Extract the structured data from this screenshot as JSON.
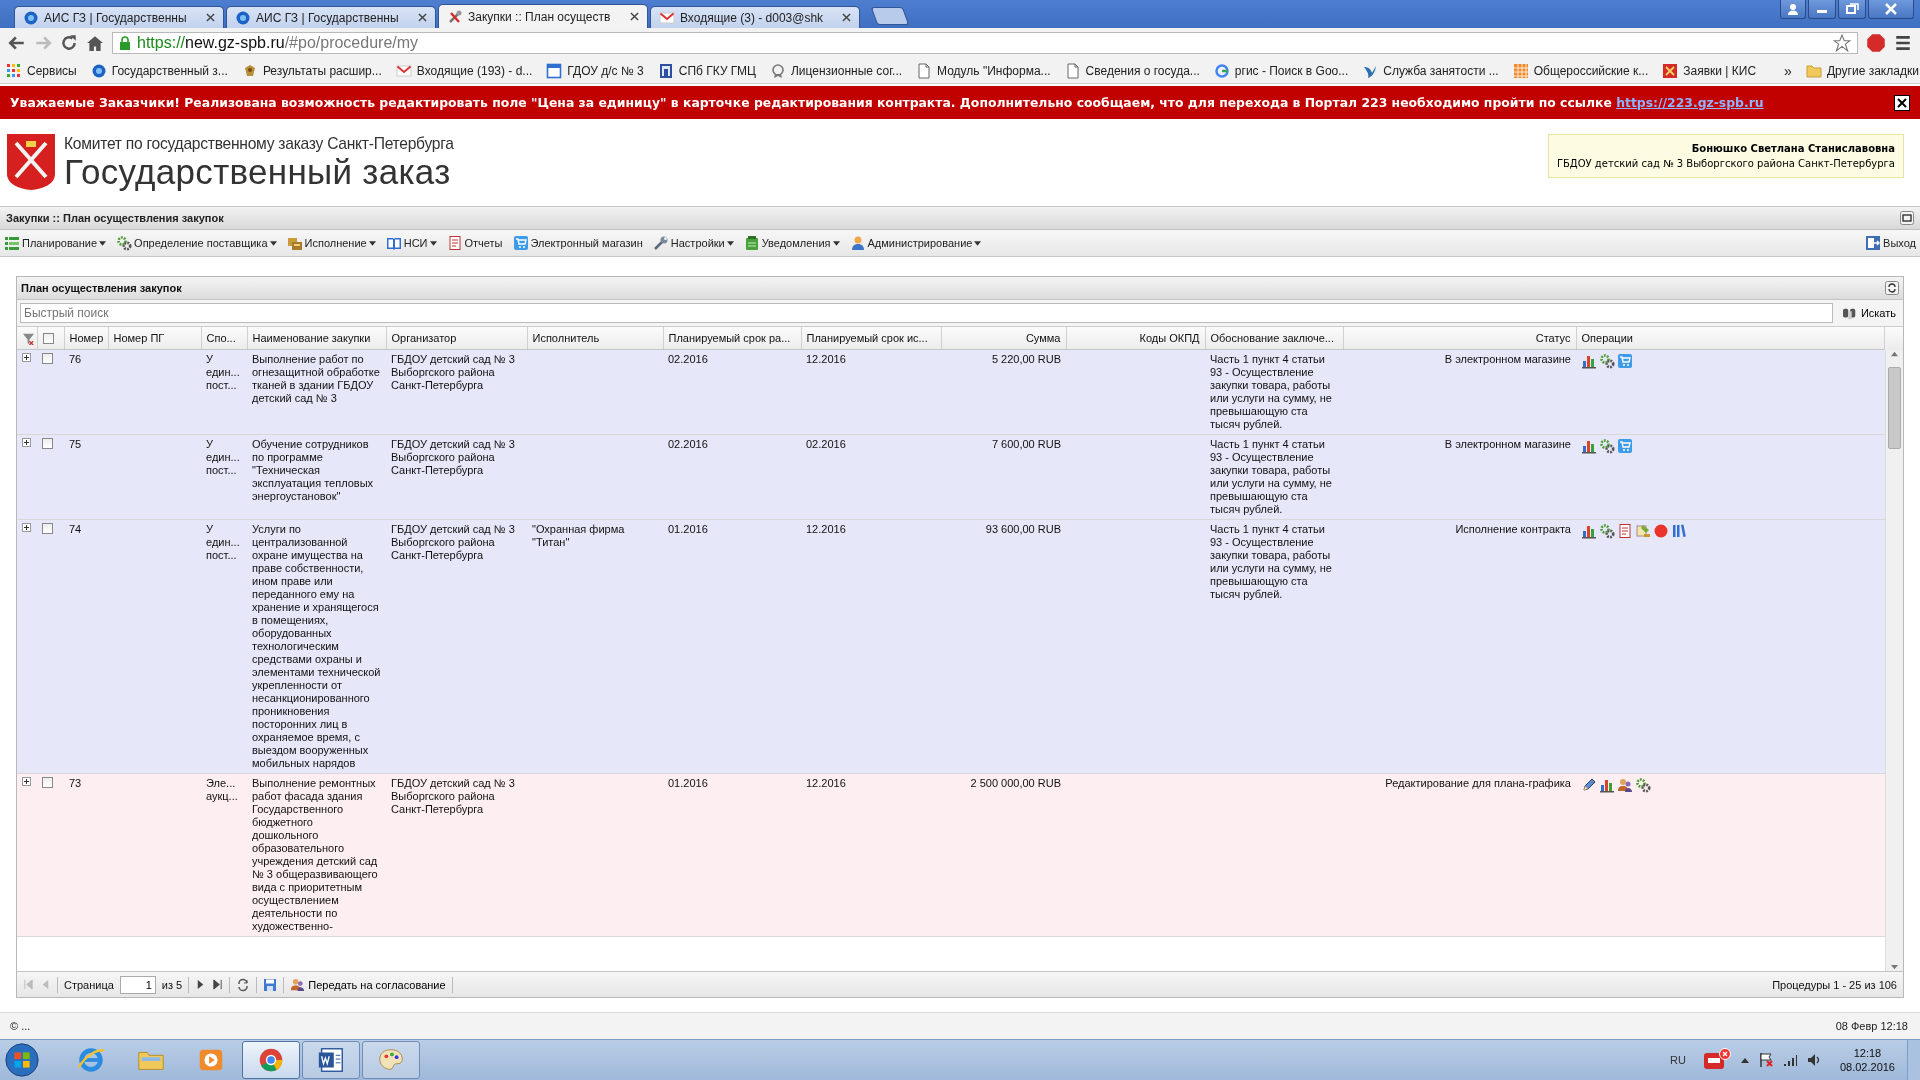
{
  "browser": {
    "tabs": [
      {
        "title": "АИС ГЗ | Государственны",
        "kind": "globe",
        "selected": false
      },
      {
        "title": "АИС ГЗ | Государственны",
        "kind": "globe",
        "selected": false
      },
      {
        "title": "Закупки :: План осуществ",
        "kind": "tools",
        "selected": true
      },
      {
        "title": "Входящие (3) - d003@shk",
        "kind": "mail",
        "selected": false
      }
    ],
    "url": {
      "scheme": "https://",
      "host": "new.gz-spb.ru",
      "path": "/#po/procedure/my"
    },
    "bookmarks": [
      {
        "label": "Сервисы",
        "kind": "apps"
      },
      {
        "label": "Государственный з...",
        "kind": "globe"
      },
      {
        "label": "Результаты расшир...",
        "kind": "emblem"
      },
      {
        "label": "Входящие (193) - d...",
        "kind": "mail"
      },
      {
        "label": "ГДОУ д/с № 3",
        "kind": "calendar"
      },
      {
        "label": "СПб ГКУ ГМЦ",
        "kind": "building"
      },
      {
        "label": "Лицензионные сог...",
        "kind": "badge"
      },
      {
        "label": "Модуль \"Информа...",
        "kind": "page"
      },
      {
        "label": "Сведения о госуда...",
        "kind": "page"
      },
      {
        "label": "ргис - Поиск в Goo...",
        "kind": "ring"
      },
      {
        "label": "Служба занятости ...",
        "kind": "bird"
      },
      {
        "label": "Общероссийские к...",
        "kind": "grid"
      },
      {
        "label": "Заявки | КИС",
        "kind": "crest"
      }
    ],
    "overflow": "»",
    "other_bookmarks": "Другие закладки"
  },
  "banner": {
    "text": "Уважаемые Заказчики! Реализована возможность редактировать поле \"Цена за единицу\" в карточке редактирования контракта. Дополнительно сообщаем, что для перехода в Портал 223 необходимо пройти по ссылке",
    "link": "https://223.gz-spb.ru"
  },
  "header": {
    "subtitle": "Комитет по государственному заказу Санкт-Петербурга",
    "title": "Государственный заказ",
    "user": {
      "name": "Бонюшко Светлана Станиславовна",
      "org": "ГБДОУ детский сад № 3 Выборгского района Санкт-Петербурга"
    }
  },
  "breadcrumb": "Закупки :: План осуществления закупок",
  "menu": [
    {
      "label": "Планирование",
      "kind": "list",
      "dropdown": true
    },
    {
      "label": "Определение поставщика",
      "kind": "gear",
      "dropdown": true
    },
    {
      "label": "Исполнение",
      "kind": "folder",
      "dropdown": true
    },
    {
      "label": "НСИ",
      "kind": "book",
      "dropdown": true
    },
    {
      "label": "Отчеты",
      "kind": "doc",
      "dropdown": false
    },
    {
      "label": "Электронный магазин",
      "kind": "cart",
      "dropdown": false
    },
    {
      "label": "Настройки",
      "kind": "wrench",
      "dropdown": true
    },
    {
      "label": "Уведомления",
      "kind": "notepad",
      "dropdown": true
    },
    {
      "label": "Администрирование",
      "kind": "person",
      "dropdown": true
    }
  ],
  "logout": "Выход",
  "panel": {
    "title": "План осуществления закупок",
    "search": {
      "placeholder": "Быстрый поиск",
      "button": "Искать"
    },
    "all_checked": false,
    "columns": [
      "Номер",
      "Номер ПГ",
      "Спо...",
      "Наименование закупки",
      "Организатор",
      "Исполнитель",
      "Планируемый срок ра...",
      "Планируемый срок ис...",
      "Сумма",
      "Коды ОКПД",
      "Обоснование заключе...",
      "Статус",
      "Операции"
    ],
    "rows": [
      {
        "expanded": false,
        "checked": false,
        "color": "#e6e7f8",
        "number": "76",
        "method": "У един... пост...",
        "name": "Выполнение работ по огнезащитной обработке тканей в здании ГБДОУ детский сад № 3",
        "organizer": "ГБДОУ детский сад № 3 Выборгского района Санкт-Петербурга",
        "start": "02.2016",
        "end": "12.2016",
        "sum": "5 220,00 RUB",
        "basis": "Часть 1 пункт 4 статьи 93 - Осуществление закупки товара, работы или услуги на сумму, не превышающую ста тысяч рублей.",
        "status": "В электронном магазине",
        "operations": [
          {
            "kind": "chart"
          },
          {
            "kind": "gear"
          },
          {
            "kind": "cart"
          }
        ]
      },
      {
        "expanded": false,
        "checked": false,
        "color": "#e6e7f8",
        "number": "75",
        "method": "У един... пост...",
        "name": "Обучение сотрудников по программе \"Техническая эксплуатация тепловых энергоустановок\"",
        "organizer": "ГБДОУ детский сад № 3 Выборгского района Санкт-Петербурга",
        "start": "02.2016",
        "end": "02.2016",
        "sum": "7 600,00 RUB",
        "basis": "Часть 1 пункт 4 статьи 93 - Осуществление закупки товара, работы или услуги на сумму, не превышающую ста тысяч рублей.",
        "status": "В электронном магазине",
        "operations": [
          {
            "kind": "chart"
          },
          {
            "kind": "gear"
          },
          {
            "kind": "cart"
          }
        ]
      },
      {
        "expanded": false,
        "checked": false,
        "color": "#e6e7f8",
        "number": "74",
        "method": "У един... пост...",
        "name": "Услуги по централизованной охране имущества на праве собственности, ином праве или переданного ему на хранение и хранящегося в помещениях, оборудованных технологическим средствами охраны и элементами технической укрепленности от несанкционированного проникновения посторонних лиц в охраняемое время, с выездом вооруженных мобильных нарядов",
        "organizer": "ГБДОУ детский сад № 3 Выборгского района Санкт-Петербурга",
        "executor": "\"Охранная фирма \"Титан\"",
        "start": "01.2016",
        "end": "12.2016",
        "sum": "93 600,00 RUB",
        "basis": "Часть 1 пункт 4 статьи 93 - Осуществление закупки товара, работы или услуги на сумму, не превышающую ста тысяч рублей.",
        "status": "Исполнение контракта",
        "operations": [
          {
            "kind": "chart"
          },
          {
            "kind": "gear"
          },
          {
            "kind": "doc"
          },
          {
            "kind": "stamp"
          },
          {
            "kind": "dot"
          },
          {
            "kind": "books"
          }
        ]
      },
      {
        "expanded": false,
        "checked": false,
        "color": "#fdeff1",
        "number": "73",
        "method": "Эле... аукц...",
        "name": "Выполнение ремонтных работ фасада здания Государственного бюджетного дошкольного образовательного учреждения детский сад № 3 общеразвивающего вида с приоритетным осуществлением деятельности по художественно-",
        "organizer": "ГБДОУ детский сад № 3 Выборгского района Санкт-Петербурга",
        "start": "01.2016",
        "end": "12.2016",
        "sum": "2 500 000,00 RUB",
        "status": "Редактирование для плана-графика",
        "operations": [
          {
            "kind": "pencil"
          },
          {
            "kind": "chart"
          },
          {
            "kind": "people"
          },
          {
            "kind": "gear"
          }
        ]
      }
    ],
    "pager": {
      "page_label": "Страница",
      "page": "1",
      "of": "из 5",
      "send": "Передать на согласование",
      "summary": "Процедуры 1 - 25 из 106"
    }
  },
  "status_bar": {
    "left": "© ...",
    "right": "08 Февр 12:18"
  },
  "taskbar": {
    "apps": [
      {
        "kind": "ie",
        "open": false,
        "selected": false
      },
      {
        "kind": "explorer",
        "open": false,
        "selected": false
      },
      {
        "kind": "media",
        "open": false,
        "selected": false
      },
      {
        "kind": "chrome",
        "open": true,
        "selected": true
      },
      {
        "kind": "word",
        "open": true,
        "selected": false
      },
      {
        "kind": "paint",
        "open": true,
        "selected": false
      }
    ],
    "language": "RU",
    "time": "12:18",
    "date": "08.02.2016"
  }
}
